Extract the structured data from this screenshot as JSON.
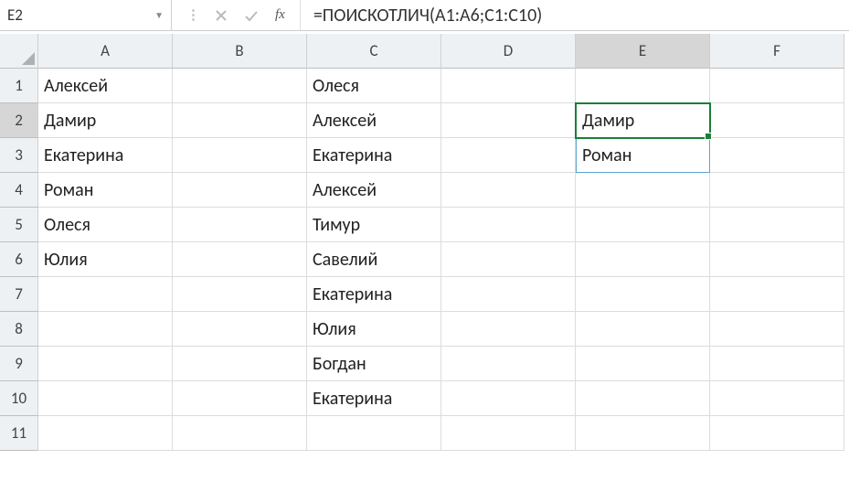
{
  "name_box": "E2",
  "formula": "=ПОИСКОТЛИЧ(A1:A6;C1:C10)",
  "columns": [
    "A",
    "B",
    "C",
    "D",
    "E",
    "F"
  ],
  "rows": [
    "1",
    "2",
    "3",
    "4",
    "5",
    "6",
    "7",
    "8",
    "9",
    "10",
    "11"
  ],
  "active_cell": "E2",
  "selected_col": "E",
  "selected_row": "2",
  "cells": {
    "A1": "Алексей",
    "A2": "Дамир",
    "A3": "Екатерина",
    "A4": "Роман",
    "A5": "Олеся",
    "A6": "Юлия",
    "C1": "Олеся",
    "C2": "Алексей",
    "C3": "Екатерина",
    "C4": "Алексей",
    "C5": "Тимур",
    "C6": "Савелий",
    "C7": "Екатерина",
    "C8": "Юлия",
    "C9": "Богдан",
    "C10": "Екатерина",
    "E2": "Дамир",
    "E3": "Роман"
  },
  "fx_label": "fx"
}
